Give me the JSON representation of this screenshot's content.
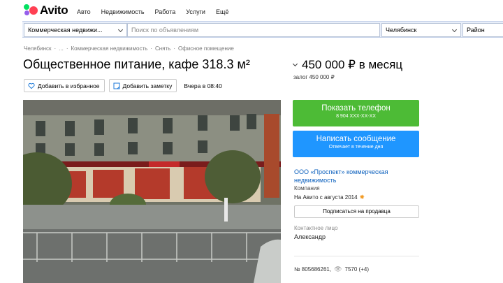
{
  "header": {
    "logo_text": "Avito",
    "nav": [
      "Авто",
      "Недвижимость",
      "Работа",
      "Услуги",
      "Ещё"
    ]
  },
  "search": {
    "category": "Коммерческая недвижи...",
    "placeholder": "Поиск по объявлениям",
    "city": "Челябинск",
    "region": "Район"
  },
  "breadcrumb": [
    "Челябинск",
    "·",
    "...",
    "·",
    "Коммерческая недвижимость",
    "·",
    "Снять",
    "·",
    "Офисное помещение"
  ],
  "listing": {
    "title": "Общественное питание, кафе 318.3 м²",
    "favorite_label": "Добавить в избранное",
    "note_label": "Добавить заметку",
    "posted": "Вчера в 08:40",
    "price": "450 000 ₽ в месяц",
    "deposit": "залог 450 000 ₽"
  },
  "contact": {
    "phone_button": "Показать телефон",
    "phone_masked": "8 904 XXX-XX-XX",
    "message_button": "Написать сообщение",
    "message_sub": "Отвечает в течение дня"
  },
  "seller": {
    "name": "ООО «Проспект» коммерческая недвижимость",
    "type": "Компания",
    "since": "На Авито с августа 2014",
    "subscribe": "Подписаться на продавца",
    "contact_label": "Контактное лицо",
    "contact_name": "Александр"
  },
  "meta": {
    "id": "№ 805686261,",
    "views": "7570 (+4)"
  },
  "colors": {
    "phone_button": "#4dbb36",
    "message_button": "#1f96ff",
    "link": "#0a5fbd"
  }
}
